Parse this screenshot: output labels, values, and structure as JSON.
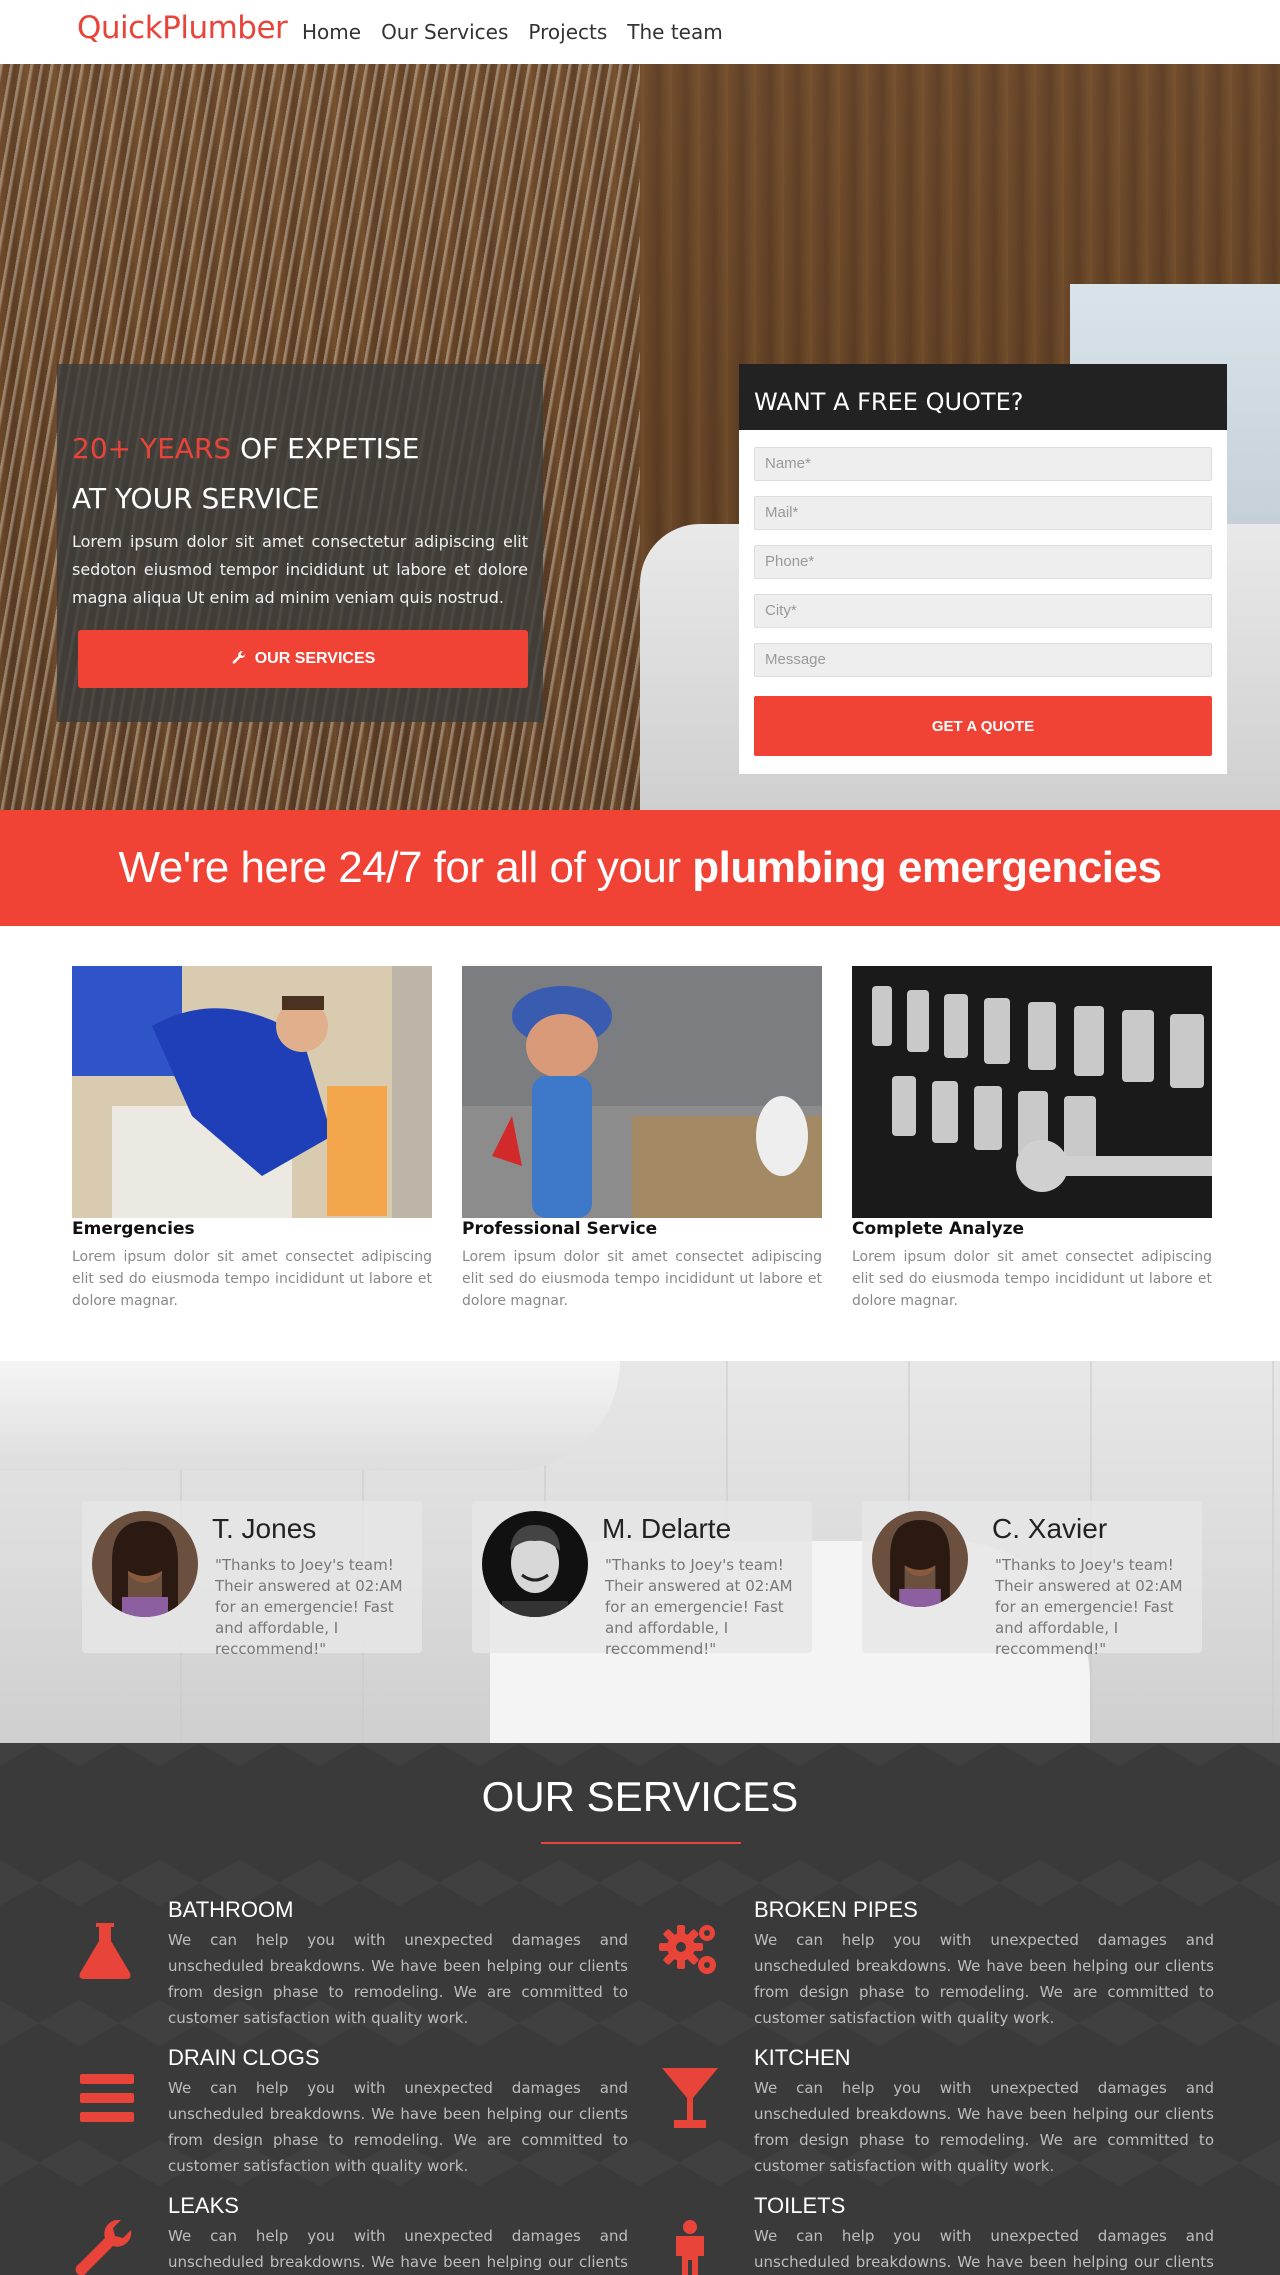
{
  "nav": {
    "brand": "QuickPlumber",
    "items": [
      "Home",
      "Our Services",
      "Projects",
      "The team"
    ]
  },
  "hero": {
    "headline_accent": "20+ YEARS",
    "headline_rest": " OF EXPETISE",
    "headline_line2": "AT YOUR SERVICE",
    "body": "Lorem ipsum dolor sit amet consectetur adipiscing elit sedoton eiusmod tempor incididunt ut labore et dolore magna aliqua Ut enim ad minim veniam quis nostrud.",
    "button": "OUR SERVICES"
  },
  "quote_form": {
    "title": "WANT A FREE QUOTE?",
    "fields": [
      "Name*",
      "Mail*",
      "Phone*",
      "City*",
      "Message"
    ],
    "button": "GET A QUOTE"
  },
  "band": {
    "text_normal": "We're here 24/7 for all of your ",
    "text_bold": "plumbing emergencies"
  },
  "features": [
    {
      "title": "Emergencies",
      "text": "Lorem ipsum dolor sit amet consectet adipiscing elit sed do eiusmoda tempo incididunt ut labore et dolore magnar."
    },
    {
      "title": "Professional Service",
      "text": "Lorem ipsum dolor sit amet consectet adipiscing elit sed do eiusmoda tempo incididunt ut labore et dolore magnar."
    },
    {
      "title": "Complete Analyze",
      "text": "Lorem ipsum dolor sit amet consectet adipiscing elit sed do eiusmoda tempo incididunt ut labore et dolore magnar."
    }
  ],
  "testimonials": [
    {
      "name": "T. Jones",
      "quote": "\"Thanks to Joey's team! Their answered at 02:AM for an emergencie! Fast and affordable, I reccommend!\""
    },
    {
      "name": "M. Delarte",
      "quote": "\"Thanks to Joey's team! Their answered at 02:AM for an emergencie! Fast and affordable, I reccommend!\""
    },
    {
      "name": "C. Xavier",
      "quote": "\"Thanks to Joey's team! Their answered at 02:AM for an emergencie! Fast and affordable, I reccommend!\""
    }
  ],
  "services": {
    "title": "OUR SERVICES",
    "items": [
      {
        "title": "BATHROOM",
        "icon": "flask-icon",
        "text": "We can help you with unexpected damages and unscheduled breakdowns. We have been helping our clients from design phase to remodeling. We are committed to customer satisfaction with quality work."
      },
      {
        "title": "BROKEN PIPES",
        "icon": "gears-icon",
        "text": "We can help you with unexpected damages and unscheduled breakdowns. We have been helping our clients from design phase to remodeling. We are committed to customer satisfaction with quality work."
      },
      {
        "title": "DRAIN CLOGS",
        "icon": "bars-icon",
        "text": "We can help you with unexpected damages and unscheduled breakdowns. We have been helping our clients from design phase to remodeling. We are committed to customer satisfaction with quality work."
      },
      {
        "title": "KITCHEN",
        "icon": "glass-icon",
        "text": "We can help you with unexpected damages and unscheduled breakdowns. We have been helping our clients from design phase to remodeling. We are committed to customer satisfaction with quality work."
      },
      {
        "title": "LEAKS",
        "icon": "wrench-icon",
        "text": "We can help you with unexpected damages and unscheduled breakdowns. We have been helping our clients from design phase to remodeling. We are committed to customer satisfaction with quality work."
      },
      {
        "title": "TOILETS",
        "icon": "person-icon",
        "text": "We can help you with unexpected damages and unscheduled breakdowns. We have been helping our clients from design phase to remodeling. We are committed to customer satisfaction with quality work."
      }
    ]
  },
  "colors": {
    "accent": "#f14236",
    "dark": "#222222",
    "services_bg": "#3a3a3a"
  }
}
